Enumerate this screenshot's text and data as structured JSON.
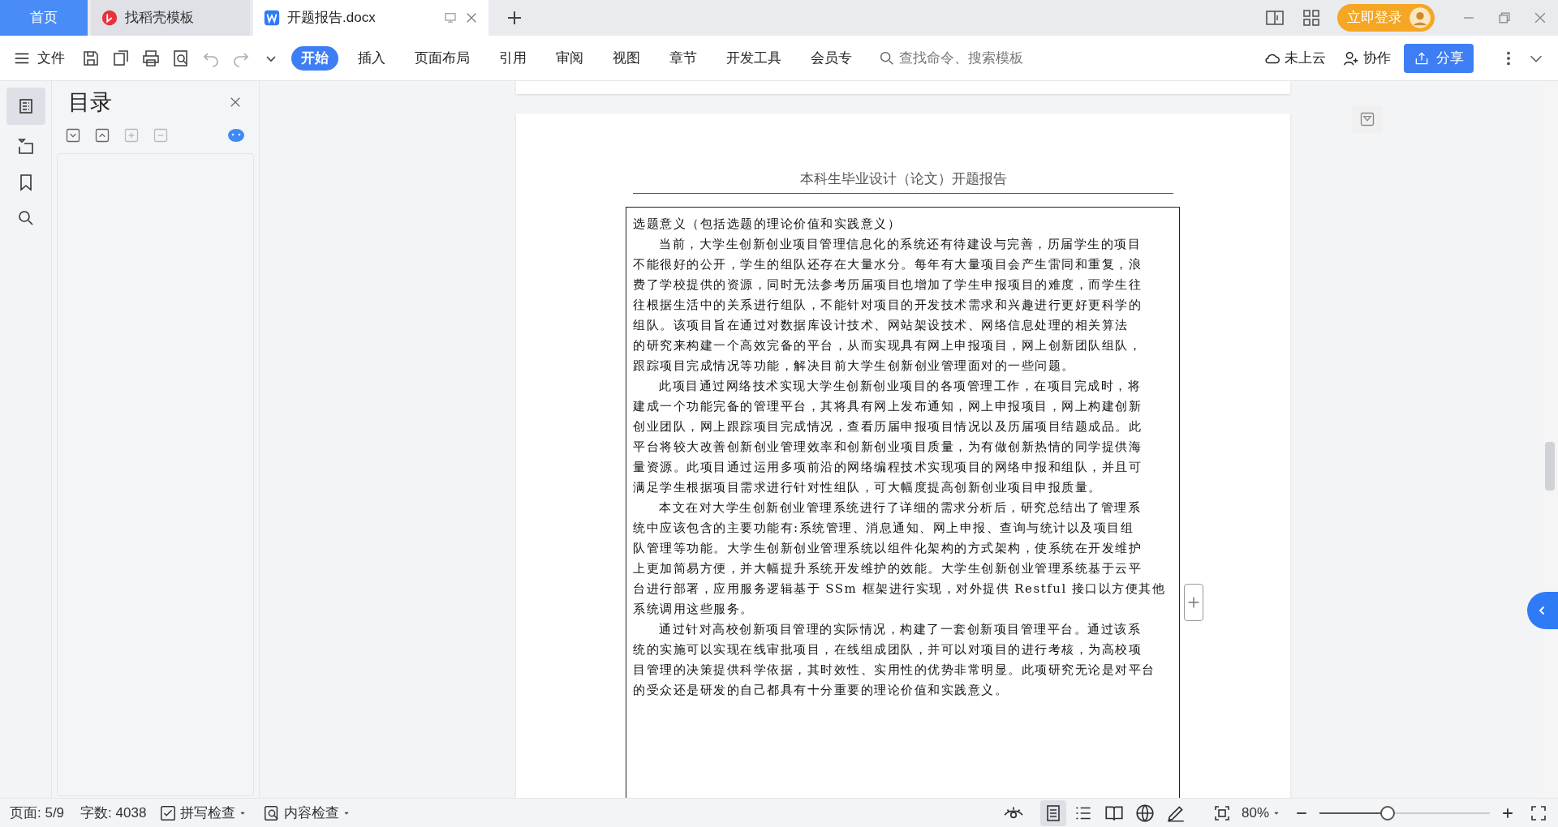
{
  "tabs": [
    {
      "kind": "home",
      "label": "首页",
      "selected": false
    },
    {
      "kind": "template",
      "label": "找稻壳模板",
      "selected": false
    },
    {
      "kind": "doc",
      "label": "开题报告.docx",
      "selected": true
    }
  ],
  "login_button": "立即登录",
  "toolbar": {
    "file_menu": "文件",
    "ribbon_tabs": [
      {
        "label": "开始",
        "selected": true
      },
      {
        "label": "插入",
        "selected": false
      },
      {
        "label": "页面布局",
        "selected": false
      },
      {
        "label": "引用",
        "selected": false
      },
      {
        "label": "审阅",
        "selected": false
      },
      {
        "label": "视图",
        "selected": false
      },
      {
        "label": "章节",
        "selected": false
      },
      {
        "label": "开发工具",
        "selected": false
      },
      {
        "label": "会员专",
        "selected": false
      }
    ],
    "search": {
      "placeholder": "查找命令、搜索模板"
    },
    "cloud": "未上云",
    "collab": "协作",
    "share": "分享"
  },
  "toc_panel": {
    "title": "目录"
  },
  "document": {
    "header": "本科生毕业设计（论文）开题报告",
    "heading": "选题意义（包括选题的理论价值和实践意义）",
    "paragraphs": [
      [
        "当前，大学生创新创业项目管理信息化的系统还有待建设与完善，历届学生的项目",
        "不能很好的公开，学生的组队还存在大量水分。每年有大量项目会产生雷同和重复，浪",
        "费了学校提供的资源，同时无法参考历届项目也增加了学生申报项目的难度，而学生往",
        "往根据生活中的关系进行组队，不能针对项目的开发技术需求和兴趣进行更好更科学的",
        "组队。该项目旨在通过对数据库设计技术、网站架设技术、网络信息处理的相关算法",
        "的研究来构建一个高效完备的平台，从而实现具有网上申报项目，网上创新团队组队，",
        "跟踪项目完成情况等功能，解决目前大学生创新创业管理面对的一些问题。"
      ],
      [
        "此项目通过网络技术实现大学生创新创业项目的各项管理工作，在项目完成时，将",
        "建成一个功能完备的管理平台，其将具有网上发布通知，网上申报项目，网上构建创新",
        "创业团队，网上跟踪项目完成情况，查看历届申报项目情况以及历届项目结题成品。此",
        "平台将较大改善创新创业管理效率和创新创业项目质量，为有做创新热情的同学提供海",
        "量资源。此项目通过运用多项前沿的网络编程技术实现项目的网络申报和组队，并且可",
        "满足学生根据项目需求进行针对性组队，可大幅度提高创新创业项目申报质量。"
      ],
      [
        "本文在对大学生创新创业管理系统进行了详细的需求分析后，研究总结出了管理系",
        "统中应该包含的主要功能有:系统管理、消息通知、网上申报、查询与统计以及项目组",
        "队管理等功能。大学生创新创业管理系统以组件化架构的方式架构，使系统在开发维护",
        "上更加简易方便，并大幅提升系统开发维护的效能。大学生创新创业管理系统基于云平",
        "台进行部署，应用服务逻辑基于 SSm 框架进行实现，对外提供 Restful 接口以方便其他",
        "系统调用这些服务。"
      ],
      [
        "通过针对高校创新项目管理的实际情况，构建了一套创新项目管理平台。通过该系",
        "统的实施可以实现在线审批项目，在线组成团队，并可以对项目的进行考核，为高校项",
        "目管理的决策提供科学依据，其时效性、实用性的优势非常明显。此项研究无论是对平台",
        "的受众还是研发的自己都具有十分重要的理论价值和实践意义。"
      ]
    ]
  },
  "status_bar": {
    "page": "页面: 5/9",
    "word_count": "字数: 4038",
    "spell_check": "拼写检查",
    "content_check": "内容检查",
    "zoom": "80%",
    "zoom_slider": {
      "level": 0.4
    }
  }
}
